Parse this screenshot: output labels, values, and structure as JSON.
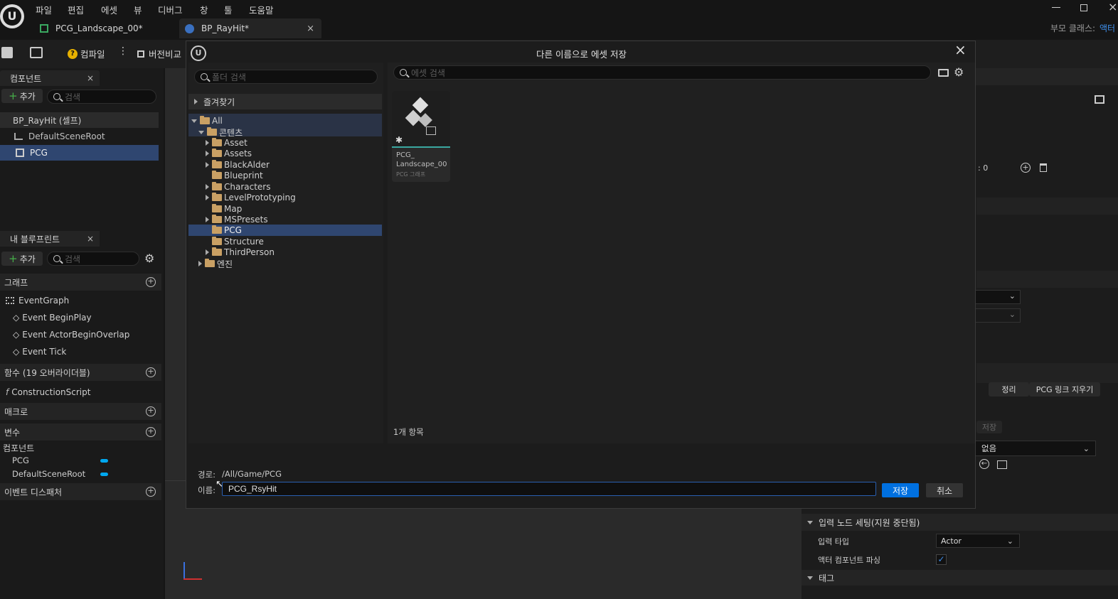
{
  "menu": [
    "파일",
    "편집",
    "에셋",
    "뷰",
    "디버그",
    "창",
    "툴",
    "도움말"
  ],
  "tabs": [
    {
      "label": "PCG_Landscape_00*"
    },
    {
      "label": "BP_RayHit*"
    }
  ],
  "parent_class": {
    "label": "부모 클래스:",
    "value": "액터"
  },
  "toolbar": {
    "compile": "컴파일",
    "diff": "버전비교"
  },
  "components_panel": {
    "title": "컴포넌트",
    "add": "추가",
    "search_placeholder": "검색",
    "items": [
      "BP_RayHit (셀프)",
      "DefaultSceneRoot",
      "PCG"
    ]
  },
  "blueprint_panel": {
    "title": "내 블루프린트",
    "add": "추가",
    "search_placeholder": "검색",
    "graph_section": "그래프",
    "graphs": [
      "EventGraph",
      "Event BeginPlay",
      "Event ActorBeginOverlap",
      "Event Tick"
    ],
    "functions_section": "함수 (19 오버라이더블)",
    "functions": [
      "ConstructionScript"
    ],
    "macros_section": "매크로",
    "variables_section": "변수",
    "components_subsection": "컴포넌트",
    "variables": [
      "PCG",
      "DefaultSceneRoot"
    ],
    "dispatchers_section": "이벤트 디스패처"
  },
  "dialog": {
    "title": "다른 이름으로 에셋 저장",
    "folder_search_placeholder": "폴더 검색",
    "asset_search_placeholder": "에셋 검색",
    "favorites": "즐겨찾기",
    "tree": {
      "root": "All",
      "content": "콘텐츠",
      "folders": [
        "Asset",
        "Assets",
        "BlackAlder",
        "Blueprint",
        "Characters",
        "LevelPrototyping",
        "Map",
        "MSPresets",
        "PCG",
        "Structure",
        "ThirdPerson"
      ],
      "engine": "엔진"
    },
    "asset_tile": {
      "name": "PCG_\nLandscape_00",
      "type": "PCG 그래프"
    },
    "item_count": "1개 항목",
    "path_label": "경로:",
    "path_value": "/All/Game/PCG",
    "name_label": "이름:",
    "name_value": "PCG_RsyHit",
    "save": "저장",
    "cancel": "취소"
  },
  "details_panel": {
    "count_label": ": 0",
    "arrange": "정리",
    "clear_links": "PCG 링크 지우기",
    "save": "저장",
    "none_option": "없음",
    "input_node_section": "입력 노드 세팅(지원 중단됨)",
    "input_type_label": "입력 타입",
    "input_type_value": "Actor",
    "parse_components_label": "액터 컴포넌트 파싱",
    "parse_components_checked": true,
    "tags_section": "태그"
  },
  "colors": {
    "accent": "#0070e0",
    "selection": "#2f4670",
    "folder": "#c9a064"
  }
}
